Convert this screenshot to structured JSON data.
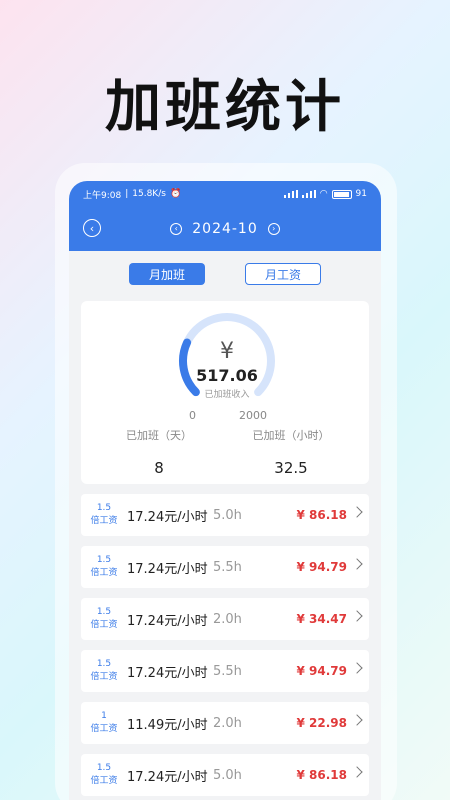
{
  "promo": {
    "title": "加班统计"
  },
  "status": {
    "time": "上午9:08",
    "speed": "15.8K/s",
    "battery": "91"
  },
  "nav": {
    "prev": "‹",
    "month": "2024-10",
    "next": "›",
    "back": "‹"
  },
  "tabs": [
    {
      "label": "月加班",
      "active": true
    },
    {
      "label": "月工资",
      "active": false
    }
  ],
  "summary": {
    "currency": "¥",
    "income": "517.06",
    "income_label": "已加班收入",
    "gauge_min": "0",
    "gauge_max": "2000",
    "gauge_fraction": 0.2585,
    "days_label": "已加班（天）",
    "days": "8",
    "hours_label": "已加班（小时）",
    "hours": "32.5"
  },
  "records": [
    {
      "mult_num": "1.5",
      "mult_unit": "倍工资",
      "rate": "17.24元/小时",
      "hours": "5.0h",
      "amount": "¥ 86.18"
    },
    {
      "mult_num": "1.5",
      "mult_unit": "倍工资",
      "rate": "17.24元/小时",
      "hours": "5.5h",
      "amount": "¥ 94.79"
    },
    {
      "mult_num": "1.5",
      "mult_unit": "倍工资",
      "rate": "17.24元/小时",
      "hours": "2.0h",
      "amount": "¥ 34.47"
    },
    {
      "mult_num": "1.5",
      "mult_unit": "倍工资",
      "rate": "17.24元/小时",
      "hours": "5.5h",
      "amount": "¥ 94.79"
    },
    {
      "mult_num": "1",
      "mult_unit": "倍工资",
      "rate": "11.49元/小时",
      "hours": "2.0h",
      "amount": "¥ 22.98"
    },
    {
      "mult_num": "1.5",
      "mult_unit": "倍工资",
      "rate": "17.24元/小时",
      "hours": "5.0h",
      "amount": "¥ 86.18"
    }
  ],
  "colors": {
    "accent": "#3a7be8",
    "amount": "#e03a3a",
    "gauge_track": "#d6e4fb"
  }
}
